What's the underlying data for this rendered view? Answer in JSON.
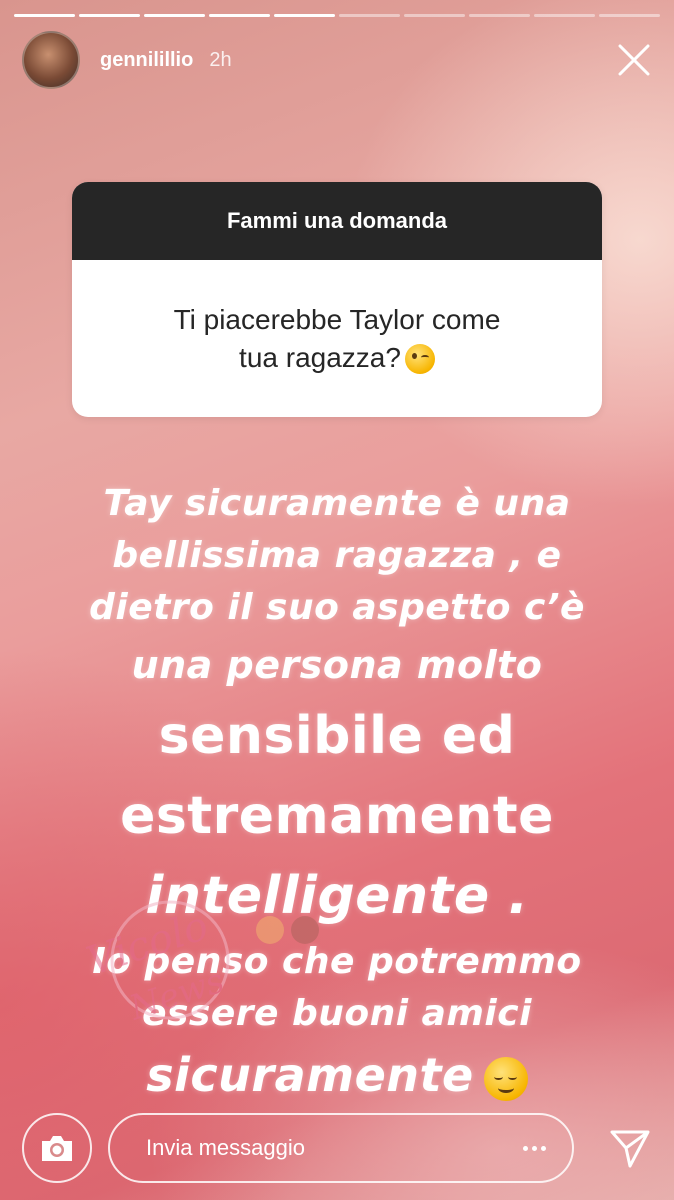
{
  "progress": {
    "total_segments": 10,
    "completed_segments": 5
  },
  "header": {
    "username": "gennilillio",
    "time": "2h"
  },
  "question": {
    "title": "Fammi una domanda",
    "line1": "Ti piacerebbe Taylor come",
    "line2": "tua ragazza?",
    "emoji": "wink-emoji"
  },
  "answer": {
    "line1": "Tay sicuramente è una",
    "line2": "bellissima ragazza , e",
    "line3": "dietro il suo aspetto c’è",
    "line4": "una persona molto",
    "line5": "sensibile ed",
    "line6": "estremamente",
    "line7": "intelligente .",
    "line8": "Io penso che potremmo",
    "line9": "essere buoni amici",
    "line10": "sicuramente",
    "emoji": "smiling-emoji"
  },
  "watermark": {
    "text1": "Vicolo",
    "text2": "News"
  },
  "composer": {
    "placeholder": "Invia messaggio"
  },
  "icons": {
    "camera": "camera-icon",
    "more": "more-icon",
    "send": "send-icon",
    "close": "close-icon"
  },
  "colors": {
    "question_header": "#262626",
    "text": "#ffffff"
  }
}
